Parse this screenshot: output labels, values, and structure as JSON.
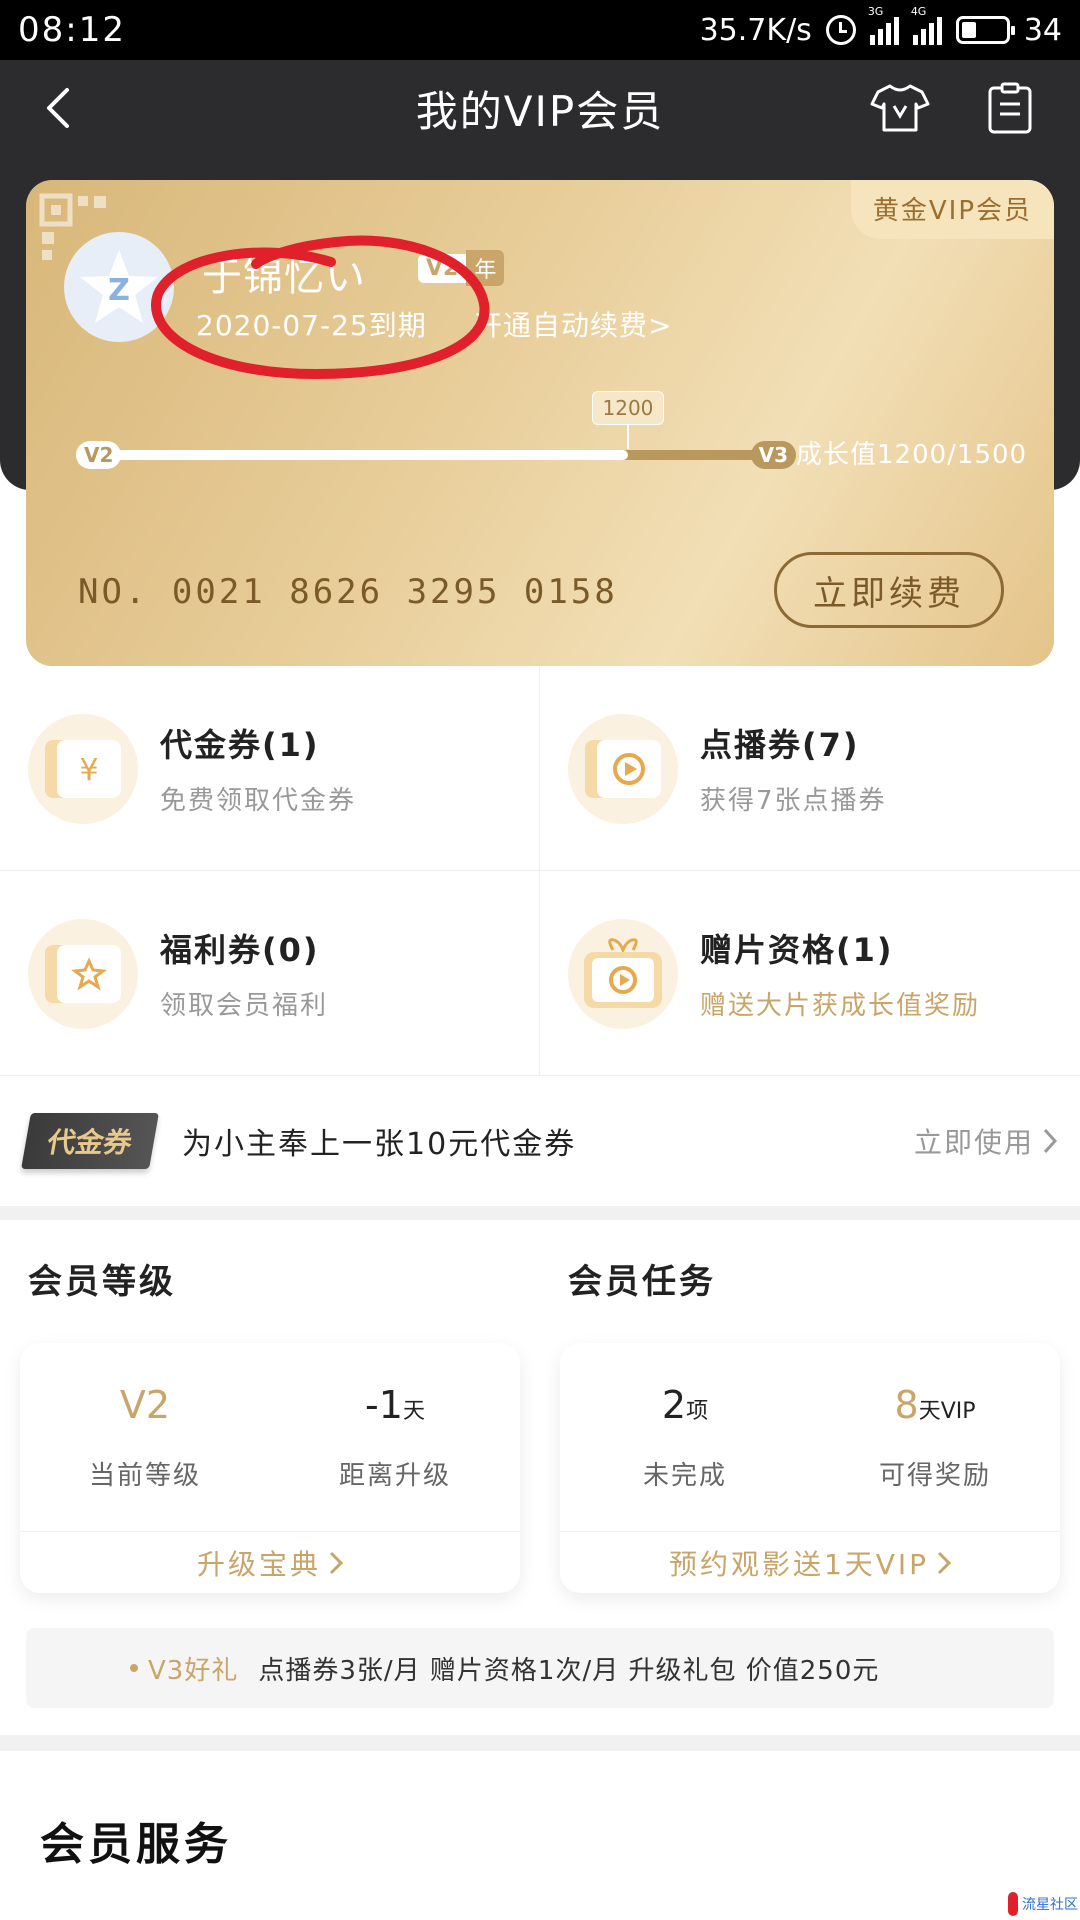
{
  "status_bar": {
    "time": "08:12",
    "speed": "35.7K/s",
    "net1": "3G",
    "net2": "4G",
    "battery": "34",
    "battery_level": 0.34
  },
  "header": {
    "title": "我的VIP会员"
  },
  "card": {
    "tag": "黄金VIP会员",
    "username": "于锦忆い",
    "level": "V2",
    "year": "年",
    "expire": "2020-07-25到期",
    "auto_renew": "开通自动续费>",
    "progress": {
      "start": "V2",
      "end": "V3",
      "current": 1200,
      "max": 1500,
      "bubble": "1200"
    },
    "growth": "成长值1200/1500",
    "card_no": "NO. 0021 8626 3295 0158",
    "renew_button": "立即续费"
  },
  "coupons": [
    {
      "title": "代金券(1)",
      "sub": "免费领取代金券",
      "icon": "yuan-ticket-icon"
    },
    {
      "title": "点播券(7)",
      "sub": "获得7张点播券",
      "icon": "play-ticket-icon"
    },
    {
      "title": "福利券(0)",
      "sub": "领取会员福利",
      "icon": "star-ticket-icon"
    },
    {
      "title": "赠片资格(1)",
      "sub": "赠送大片获成长值奖励",
      "icon": "gift-film-icon"
    }
  ],
  "banner": {
    "tag": "代金券",
    "text": "为小主奉上一张10元代金券",
    "link": "立即使用"
  },
  "level_section": {
    "title": "会员等级",
    "stats": [
      {
        "value": "V2",
        "unit": "",
        "label": "当前等级"
      },
      {
        "value": "-1",
        "unit": "天",
        "label": "距离升级"
      }
    ],
    "footer": "升级宝典"
  },
  "task_section": {
    "title": "会员任务",
    "stats": [
      {
        "value": "2",
        "unit": "项",
        "label": "未完成"
      },
      {
        "value": "8",
        "unit": "天VIP",
        "label": "可得奖励"
      }
    ],
    "footer": "预约观影送1天VIP"
  },
  "gift": {
    "highlight": "V3好礼",
    "desc": "点播券3张/月  赠片资格1次/月  升级礼包 价值250元"
  },
  "services": {
    "title": "会员服务"
  },
  "watermark": "流星社区",
  "colors": {
    "gold": "#c9a56a",
    "dark_header": "#2c2c2e",
    "annotation_red": "#e0202a"
  }
}
